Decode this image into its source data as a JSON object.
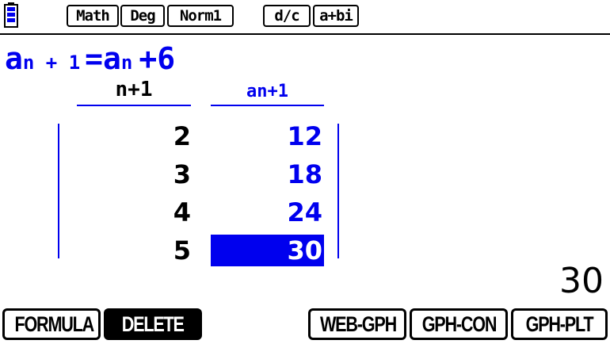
{
  "colors": {
    "accent": "#0000ee",
    "background": "#ffffff",
    "text": "#000000"
  },
  "status_bar": {
    "battery_icon": "battery-icon",
    "math": "Math",
    "angle": "Deg",
    "display": "Norm1",
    "fraction": "d/c",
    "complex": "a+bi"
  },
  "formula": {
    "lhs_a": "a",
    "lhs_sub": "n + 1",
    "eq": "=",
    "rhs_a": "a",
    "rhs_sub": "n",
    "rhs_tail": "+6"
  },
  "table": {
    "headers": [
      "n+1",
      "an+1"
    ],
    "rows": [
      {
        "n": "2",
        "a": "12"
      },
      {
        "n": "3",
        "a": "18"
      },
      {
        "n": "4",
        "a": "24"
      },
      {
        "n": "5",
        "a": "30"
      }
    ],
    "selected_row": 3
  },
  "result": "30",
  "function_keys": [
    {
      "label": "FORMULA",
      "inverted": false
    },
    {
      "label": "DELETE",
      "inverted": true
    },
    {
      "label": "",
      "inverted": false
    },
    {
      "label": "WEB-GPH",
      "inverted": false
    },
    {
      "label": "GPH-CON",
      "inverted": false
    },
    {
      "label": "GPH-PLT",
      "inverted": false
    }
  ]
}
